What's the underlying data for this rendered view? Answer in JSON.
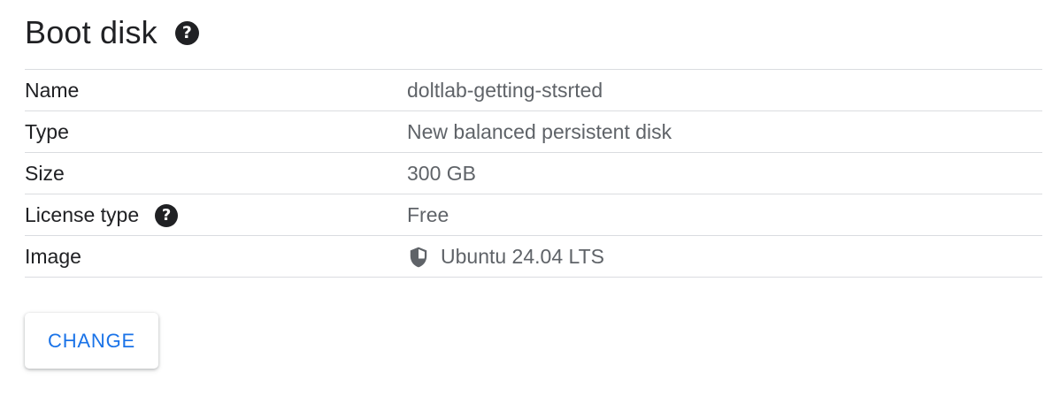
{
  "section": {
    "title": "Boot disk",
    "help_icon": "question-circle-icon",
    "help_glyph": "?"
  },
  "rows": [
    {
      "label": "Name",
      "value": "doltlab-getting-stsrted"
    },
    {
      "label": "Type",
      "value": "New balanced persistent disk"
    },
    {
      "label": "Size",
      "value": "300 GB"
    },
    {
      "label": "License type",
      "value": "Free",
      "label_help_icon": "question-circle-icon"
    },
    {
      "label": "Image",
      "value": "Ubuntu 24.04 LTS",
      "value_icon": "shield-icon"
    }
  ],
  "actions": {
    "change_label": "CHANGE"
  },
  "colors": {
    "text_primary": "#202124",
    "text_secondary": "#5f6368",
    "divider": "#dadce0",
    "accent": "#1a73e8"
  }
}
